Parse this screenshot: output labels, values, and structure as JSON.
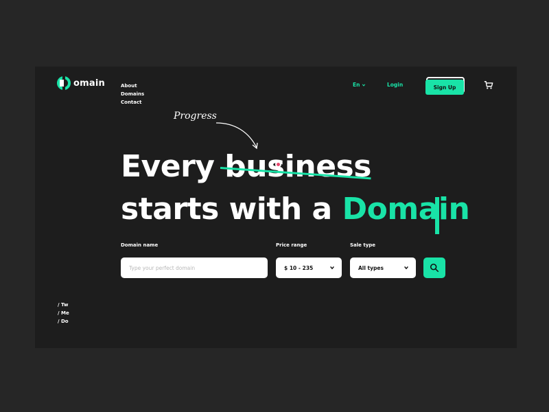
{
  "brand": {
    "logo_text": "omain",
    "accent_color": "#19e3a7"
  },
  "nav": {
    "items": [
      "About",
      "Domains",
      "Contact"
    ]
  },
  "header": {
    "language": "En",
    "login": "Login",
    "signup": "Sign Up"
  },
  "hero": {
    "annotation": "Progress",
    "line1_word": "Every",
    "struck_word": "business",
    "line2_prefix": "starts with a",
    "line2_accent": "Domain"
  },
  "search": {
    "domain_label": "Domain name",
    "domain_placeholder": "Type your perfect domain",
    "price_label": "Price range",
    "price_value": "$ 10 - 235",
    "sale_label": "Sale type",
    "sale_value": "All types"
  },
  "socials": [
    "/ Tw",
    "/ Me",
    "/ Do"
  ]
}
